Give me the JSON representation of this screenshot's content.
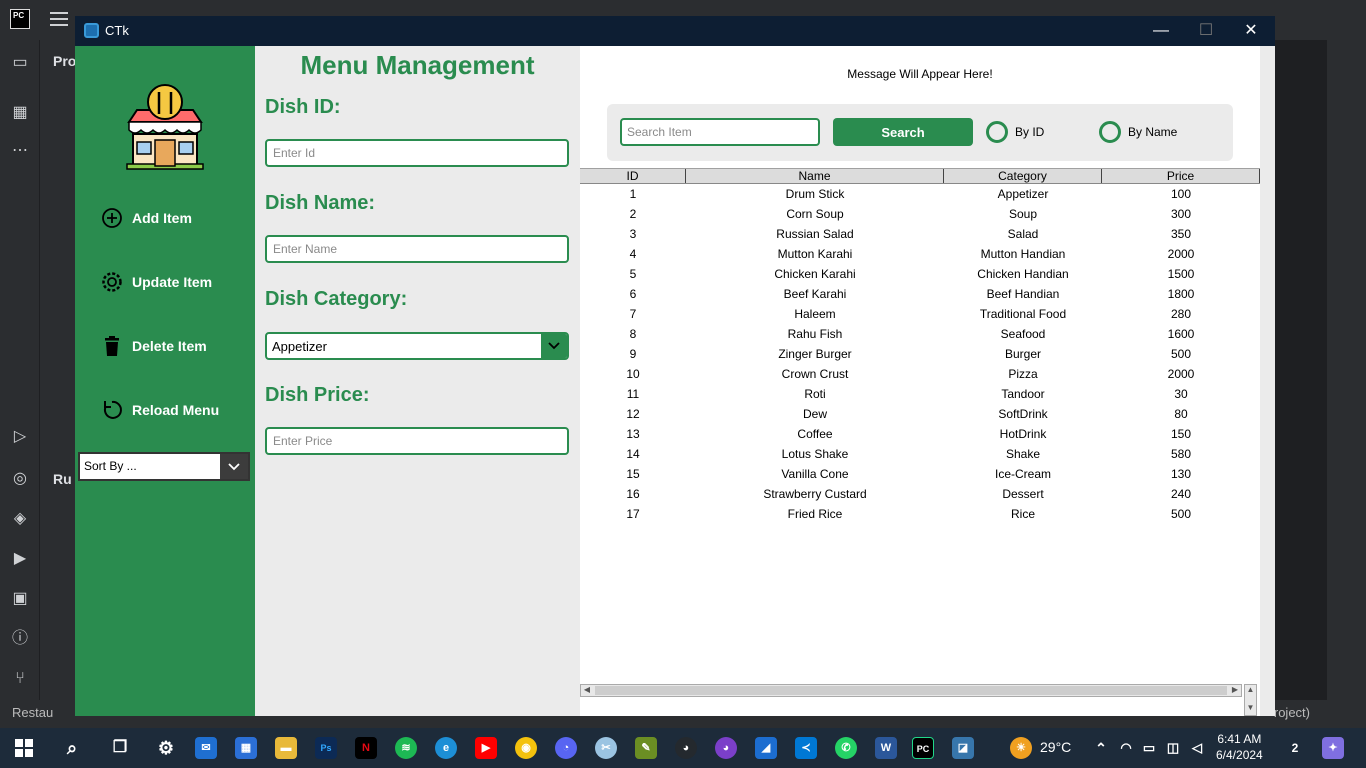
{
  "window": {
    "title": "CTk"
  },
  "sidebar": {
    "items": [
      {
        "label": "Add Item",
        "icon": "plus-circle-icon"
      },
      {
        "label": "Update Item",
        "icon": "gear-icon"
      },
      {
        "label": "Delete Item",
        "icon": "trash-icon"
      },
      {
        "label": "Reload Menu",
        "icon": "reload-icon"
      }
    ],
    "sort": {
      "value": "Sort By ..."
    }
  },
  "form": {
    "heading": "Menu Management",
    "id_label": "Dish ID:",
    "id_placeholder": "Enter Id",
    "name_label": "Dish Name:",
    "name_placeholder": "Enter Name",
    "category_label": "Dish Category:",
    "category_value": "Appetizer",
    "price_label": "Dish Price:",
    "price_placeholder": "Enter Price"
  },
  "panel": {
    "message": "Message Will Appear Here!",
    "search_placeholder": "Search Item",
    "search_button": "Search",
    "radio_by_id": "By ID",
    "radio_by_name": "By Name"
  },
  "table": {
    "headers": [
      "ID",
      "Name",
      "Category",
      "Price"
    ],
    "rows": [
      [
        "1",
        "Drum Stick",
        "Appetizer",
        "100"
      ],
      [
        "2",
        "Corn Soup",
        "Soup",
        "300"
      ],
      [
        "3",
        "Russian Salad",
        "Salad",
        "350"
      ],
      [
        "4",
        "Mutton Karahi",
        "Mutton Handian",
        "2000"
      ],
      [
        "5",
        "Chicken Karahi",
        "Chicken Handian",
        "1500"
      ],
      [
        "6",
        "Beef Karahi",
        "Beef Handian",
        "1800"
      ],
      [
        "7",
        "Haleem",
        "Traditional Food",
        "280"
      ],
      [
        "8",
        "Rahu Fish",
        "Seafood",
        "1600"
      ],
      [
        "9",
        "Zinger Burger",
        "Burger",
        "500"
      ],
      [
        "10",
        "Crown Crust",
        "Pizza",
        "2000"
      ],
      [
        "11",
        "Roti",
        "Tandoor",
        "30"
      ],
      [
        "12",
        "Dew",
        "SoftDrink",
        "80"
      ],
      [
        "13",
        "Coffee",
        "HotDrink",
        "150"
      ],
      [
        "14",
        "Lotus Shake",
        "Shake",
        "580"
      ],
      [
        "15",
        "Vanilla Cone",
        "Ice-Cream",
        "130"
      ],
      [
        "16",
        "Strawberry Custard",
        "Dessert",
        "240"
      ],
      [
        "17",
        "Fried Rice",
        "Rice",
        "500"
      ]
    ]
  },
  "ide": {
    "logo": "PC",
    "project_label": "Pro",
    "run_label": "Ru",
    "status_left": "Restau",
    "status_right": "roject)"
  },
  "taskbar": {
    "temperature": "29°C",
    "time": "6:41 AM",
    "date": "6/4/2024",
    "notification_count": "2"
  },
  "colors": {
    "accent_green": "#2a8c4f",
    "title_bar": "#0d1e33",
    "panel_gray": "#ebebeb"
  }
}
